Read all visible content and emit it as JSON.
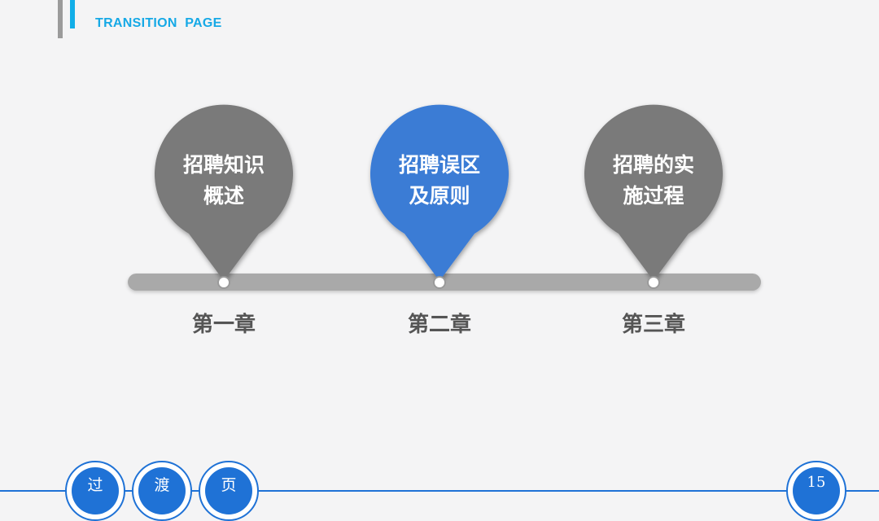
{
  "header": {
    "title": "TRANSITION  PAGE"
  },
  "colors": {
    "accent_blue": "#3a7bd5",
    "pin_gray": "#7a7a7a",
    "timeline_gray": "#a9a9a9",
    "header_blue": "#16a9e6",
    "nav_blue": "#1f72d6"
  },
  "chapters": [
    {
      "pin_line1": "招聘知识",
      "pin_line2": "概述",
      "label": "第一章",
      "active": false
    },
    {
      "pin_line1": "招聘误区",
      "pin_line2": "及原则",
      "label": "第二章",
      "active": true
    },
    {
      "pin_line1": "招聘的实",
      "pin_line2": "施过程",
      "label": "第三章",
      "active": false
    }
  ],
  "footer": {
    "tabs": [
      {
        "label": "过"
      },
      {
        "label": "渡"
      },
      {
        "label": "页"
      }
    ],
    "page_number": "15"
  }
}
